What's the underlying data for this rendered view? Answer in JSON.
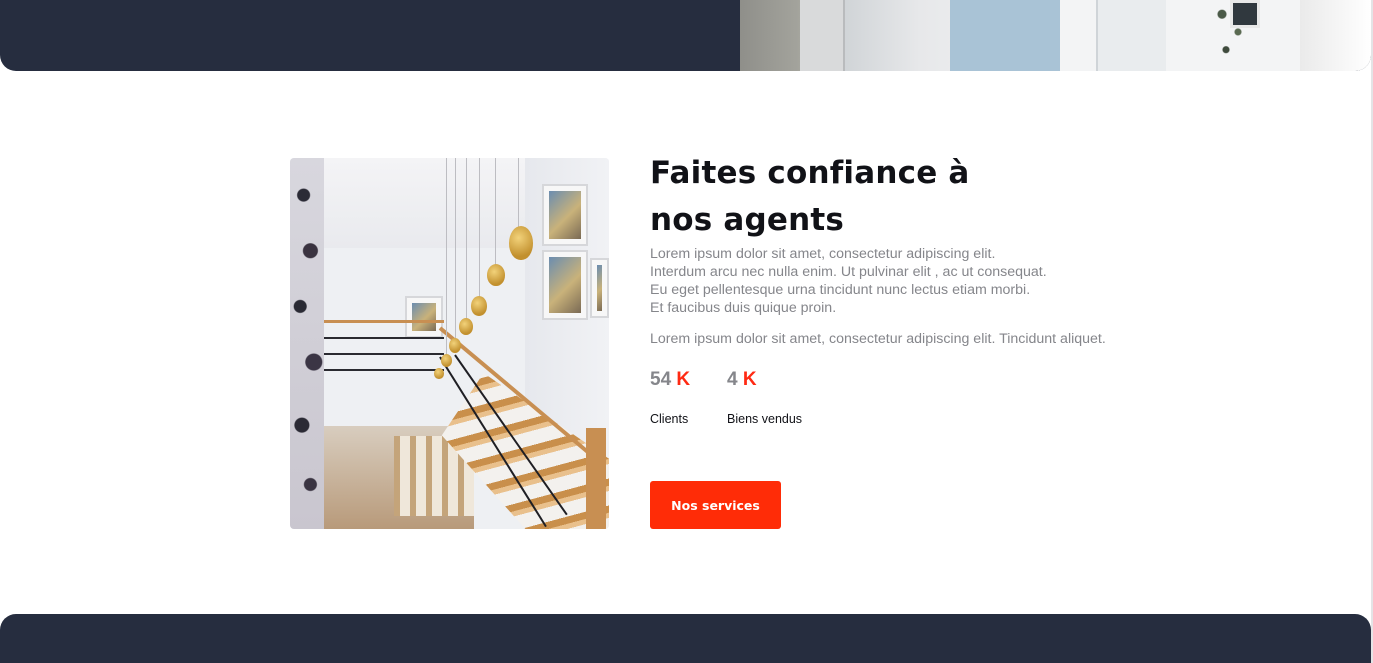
{
  "about": {
    "heading": "Faites confiance à nos agents",
    "paragraph_lines": [
      "Lorem ipsum dolor sit amet, consectetur adipiscing elit.",
      "Interdum arcu nec nulla enim. Ut pulvinar elit , ac ut consequat.",
      "Eu eget pellentesque urna tincidunt nunc lectus etiam morbi.",
      "Et faucibus duis quique proin."
    ],
    "paragraph2": "Lorem ipsum dolor sit amet, consectetur adipiscing elit. Tincidunt aliquet.",
    "stats": [
      {
        "number": "54",
        "unit": "K",
        "label": "Clients"
      },
      {
        "number": "4",
        "unit": "K",
        "label": "Biens vendus"
      }
    ],
    "button_label": "Nos services"
  },
  "colors": {
    "dark_band": "#262d3f",
    "accent": "#ff2c07",
    "muted_text": "#85868b",
    "heading_text": "#111217"
  }
}
